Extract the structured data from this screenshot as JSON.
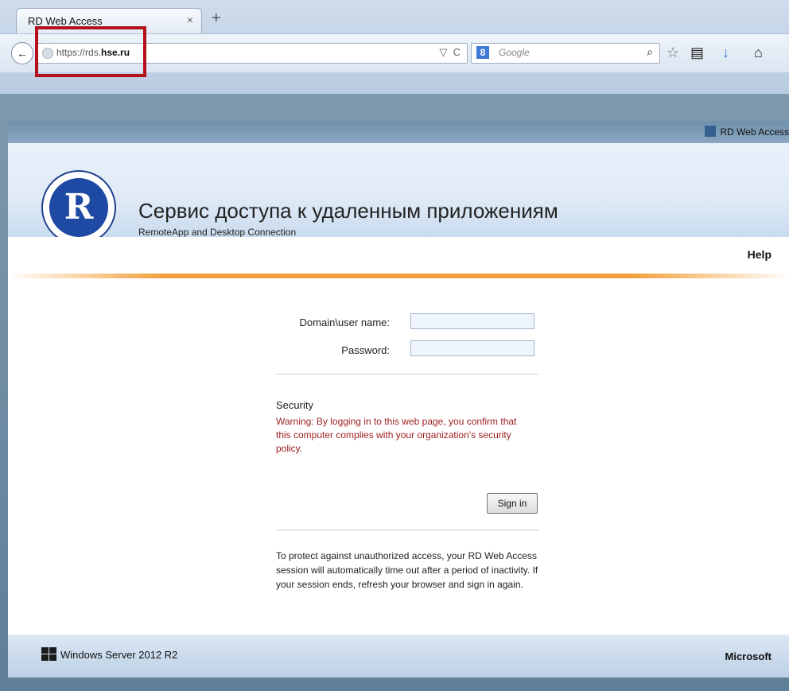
{
  "browser": {
    "tab_title": "RD Web Access",
    "tab_close": "×",
    "new_tab": "+",
    "back_icon": "←",
    "url_prefix": "https://rds.",
    "url_host": "hse.ru",
    "url_dropdown": "▽",
    "reload_icon": "C",
    "search_engine_badge": "8",
    "search_placeholder": "Google",
    "search_go_icon": "⌕",
    "toolbar_icons": [
      "☆",
      "▤",
      "↓",
      "⌂"
    ]
  },
  "header": {
    "rdweb_link": "RD Web Access",
    "title_ru": "Сервис доступа к удаленным приложениям",
    "subtitle": "RemoteApp and Desktop Connection",
    "help": "Help"
  },
  "form": {
    "username_label": "Domain\\user name:",
    "username_value": "",
    "password_label": "Password:",
    "password_value": "",
    "security_title": "Security",
    "warning": "Warning: By logging in to this web page, you confirm that this computer complies with your organization's security policy.",
    "signin_label": "Sign in",
    "timeout_note": "To protect against unauthorized access, your RD Web Access session will automatically time out after a period of inactivity. If your session ends, refresh your browser and sign in again."
  },
  "footer": {
    "windows_server": "Windows Server 2012 R2",
    "microsoft": "Microsoft"
  },
  "colors": {
    "warning_red": "#9d1d1d",
    "accent_orange": "#f2a03b",
    "highlight_red": "#b3101b",
    "logo_blue": "#1e4aa3"
  }
}
